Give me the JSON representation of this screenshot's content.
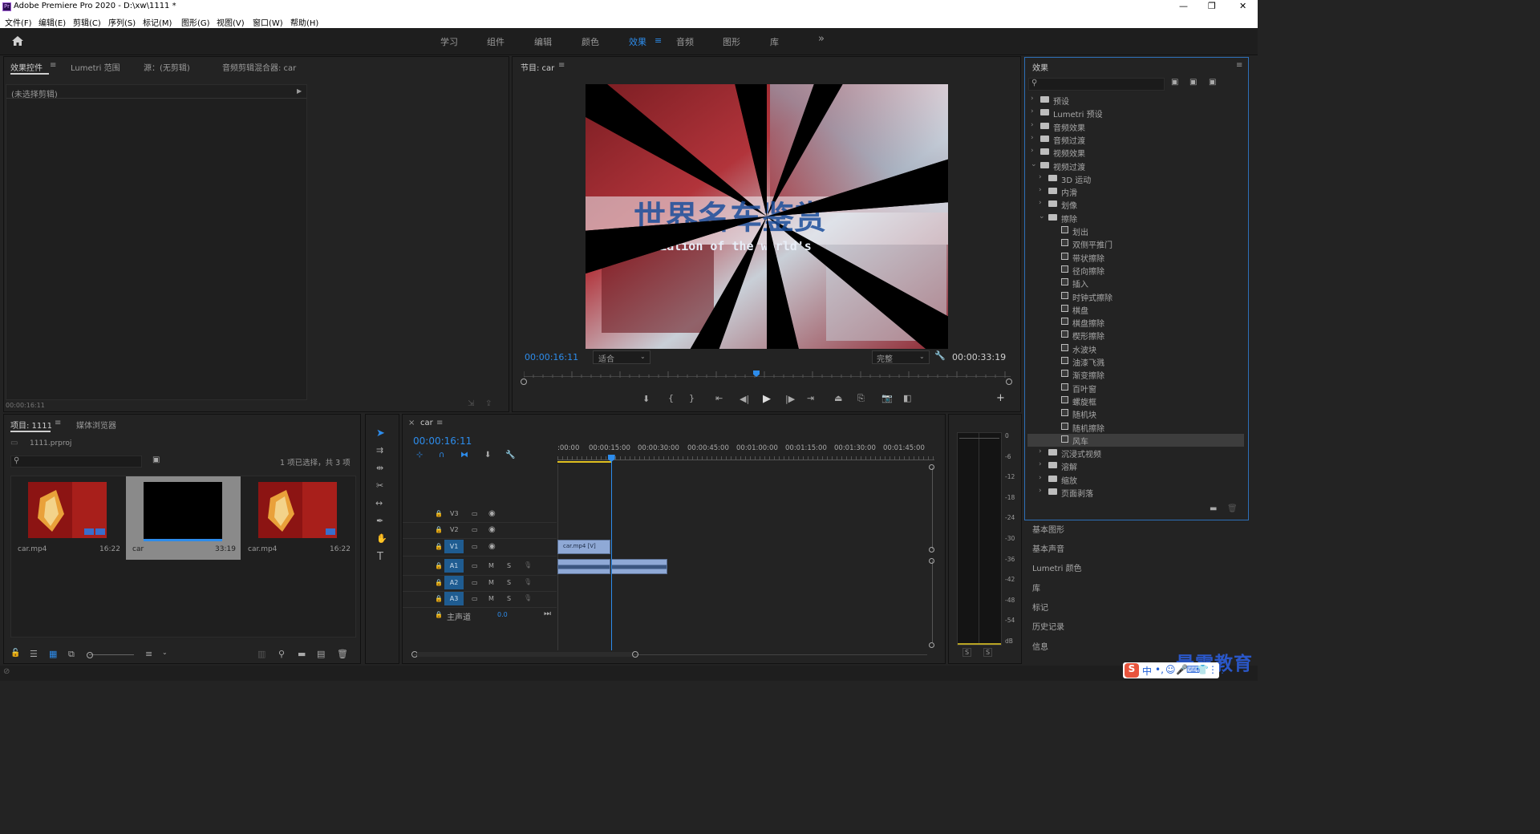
{
  "window": {
    "title": "Adobe Premiere Pro 2020 - D:\\xw\\1111 *",
    "app_icon": "Pr",
    "controls": [
      "—",
      "❐",
      "✕"
    ]
  },
  "menu": [
    "文件(F)",
    "编辑(E)",
    "剪辑(C)",
    "序列(S)",
    "标记(M)",
    "图形(G)",
    "视图(V)",
    "窗口(W)",
    "帮助(H)"
  ],
  "workspaces": {
    "tabs": [
      "学习",
      "组件",
      "编辑",
      "颜色",
      "效果",
      "音频",
      "图形",
      "库"
    ],
    "active": "效果",
    "more": "»"
  },
  "source_panel": {
    "tabs": [
      "效果控件",
      "Lumetri 范围",
      "源：(无剪辑)",
      "音频剪辑混合器: car"
    ],
    "no_clip": "(未选择剪辑)",
    "timecode": "00:00:16:11"
  },
  "program_monitor": {
    "title": "节目: car",
    "current_time": "00:00:16:11",
    "fit": "适合",
    "quality": "完整",
    "duration": "00:00:33:19",
    "overlay_text_cn": "世界名车鉴赏",
    "overlay_text_en": "Appreciation of the world's"
  },
  "project_panel": {
    "tabs": [
      "项目: 1111",
      "媒体浏览器"
    ],
    "project_file": "1111.prproj",
    "selection": "1 项已选择，共 3 项",
    "items": [
      {
        "name": "car.mp4",
        "duration": "16:22"
      },
      {
        "name": "car",
        "duration": "33:19"
      },
      {
        "name": "car.mp4",
        "duration": "16:22"
      }
    ]
  },
  "timeline": {
    "tab": "car",
    "timecode": "00:00:16:11",
    "ruler": [
      ":00:00",
      "00:00:15:00",
      "00:00:30:00",
      "00:00:45:00",
      "00:01:00:00",
      "00:01:15:00",
      "00:01:30:00",
      "00:01:45:00"
    ],
    "playhead_seconds": 16.4,
    "tracks": [
      "V3",
      "V2",
      "V1",
      "A1",
      "A2",
      "A3"
    ],
    "master": "主声道",
    "master_value": "0.0",
    "clip_label": "car.mp4 [V]",
    "m": "M",
    "s": "S"
  },
  "audio_meter": {
    "scale": [
      "0",
      "-6",
      "-12",
      "-18",
      "-24",
      "-30",
      "-36",
      "-42",
      "-48",
      "-54",
      "dB"
    ],
    "solo": [
      "S",
      "S"
    ]
  },
  "effects_panel": {
    "title": "效果",
    "tree": [
      {
        "label": "预设",
        "level": 0,
        "kind": "folder",
        "open": false
      },
      {
        "label": "Lumetri 预设",
        "level": 0,
        "kind": "folder",
        "open": false
      },
      {
        "label": "音频效果",
        "level": 0,
        "kind": "folder",
        "open": false
      },
      {
        "label": "音频过渡",
        "level": 0,
        "kind": "folder",
        "open": false
      },
      {
        "label": "视频效果",
        "level": 0,
        "kind": "folder",
        "open": false
      },
      {
        "label": "视频过渡",
        "level": 0,
        "kind": "folder",
        "open": true
      },
      {
        "label": "3D 运动",
        "level": 1,
        "kind": "folder",
        "open": false
      },
      {
        "label": "内滑",
        "level": 1,
        "kind": "folder",
        "open": false
      },
      {
        "label": "划像",
        "level": 1,
        "kind": "folder",
        "open": false
      },
      {
        "label": "擦除",
        "level": 1,
        "kind": "folder",
        "open": true
      },
      {
        "label": "划出",
        "level": 2,
        "kind": "fx"
      },
      {
        "label": "双侧平推门",
        "level": 2,
        "kind": "fx"
      },
      {
        "label": "带状擦除",
        "level": 2,
        "kind": "fx"
      },
      {
        "label": "径向擦除",
        "level": 2,
        "kind": "fx"
      },
      {
        "label": "插入",
        "level": 2,
        "kind": "fx"
      },
      {
        "label": "时钟式擦除",
        "level": 2,
        "kind": "fx"
      },
      {
        "label": "棋盘",
        "level": 2,
        "kind": "fx"
      },
      {
        "label": "棋盘擦除",
        "level": 2,
        "kind": "fx"
      },
      {
        "label": "楔形擦除",
        "level": 2,
        "kind": "fx"
      },
      {
        "label": "水波块",
        "level": 2,
        "kind": "fx"
      },
      {
        "label": "油漆飞溅",
        "level": 2,
        "kind": "fx"
      },
      {
        "label": "渐变擦除",
        "level": 2,
        "kind": "fx"
      },
      {
        "label": "百叶窗",
        "level": 2,
        "kind": "fx"
      },
      {
        "label": "螺旋框",
        "level": 2,
        "kind": "fx"
      },
      {
        "label": "随机块",
        "level": 2,
        "kind": "fx"
      },
      {
        "label": "随机擦除",
        "level": 2,
        "kind": "fx"
      },
      {
        "label": "风车",
        "level": 2,
        "kind": "fx",
        "selected": true
      },
      {
        "label": "沉浸式视频",
        "level": 1,
        "kind": "folder",
        "open": false
      },
      {
        "label": "溶解",
        "level": 1,
        "kind": "folder",
        "open": false
      },
      {
        "label": "缩放",
        "level": 1,
        "kind": "folder",
        "open": false
      },
      {
        "label": "页面剥落",
        "level": 1,
        "kind": "folder",
        "open": false
      }
    ],
    "lower_panels": [
      "基本图形",
      "基本声音",
      "Lumetri 颜色",
      "库",
      "标记",
      "历史记录",
      "信息"
    ]
  },
  "watermark": "最需教育",
  "ime": [
    "中",
    "•,",
    "☺",
    "🎤",
    "⌨",
    "👕",
    "⋮⋮"
  ],
  "colors": {
    "accent": "#2d8ceb",
    "panel": "#232323",
    "bg": "#1b1b1b"
  }
}
